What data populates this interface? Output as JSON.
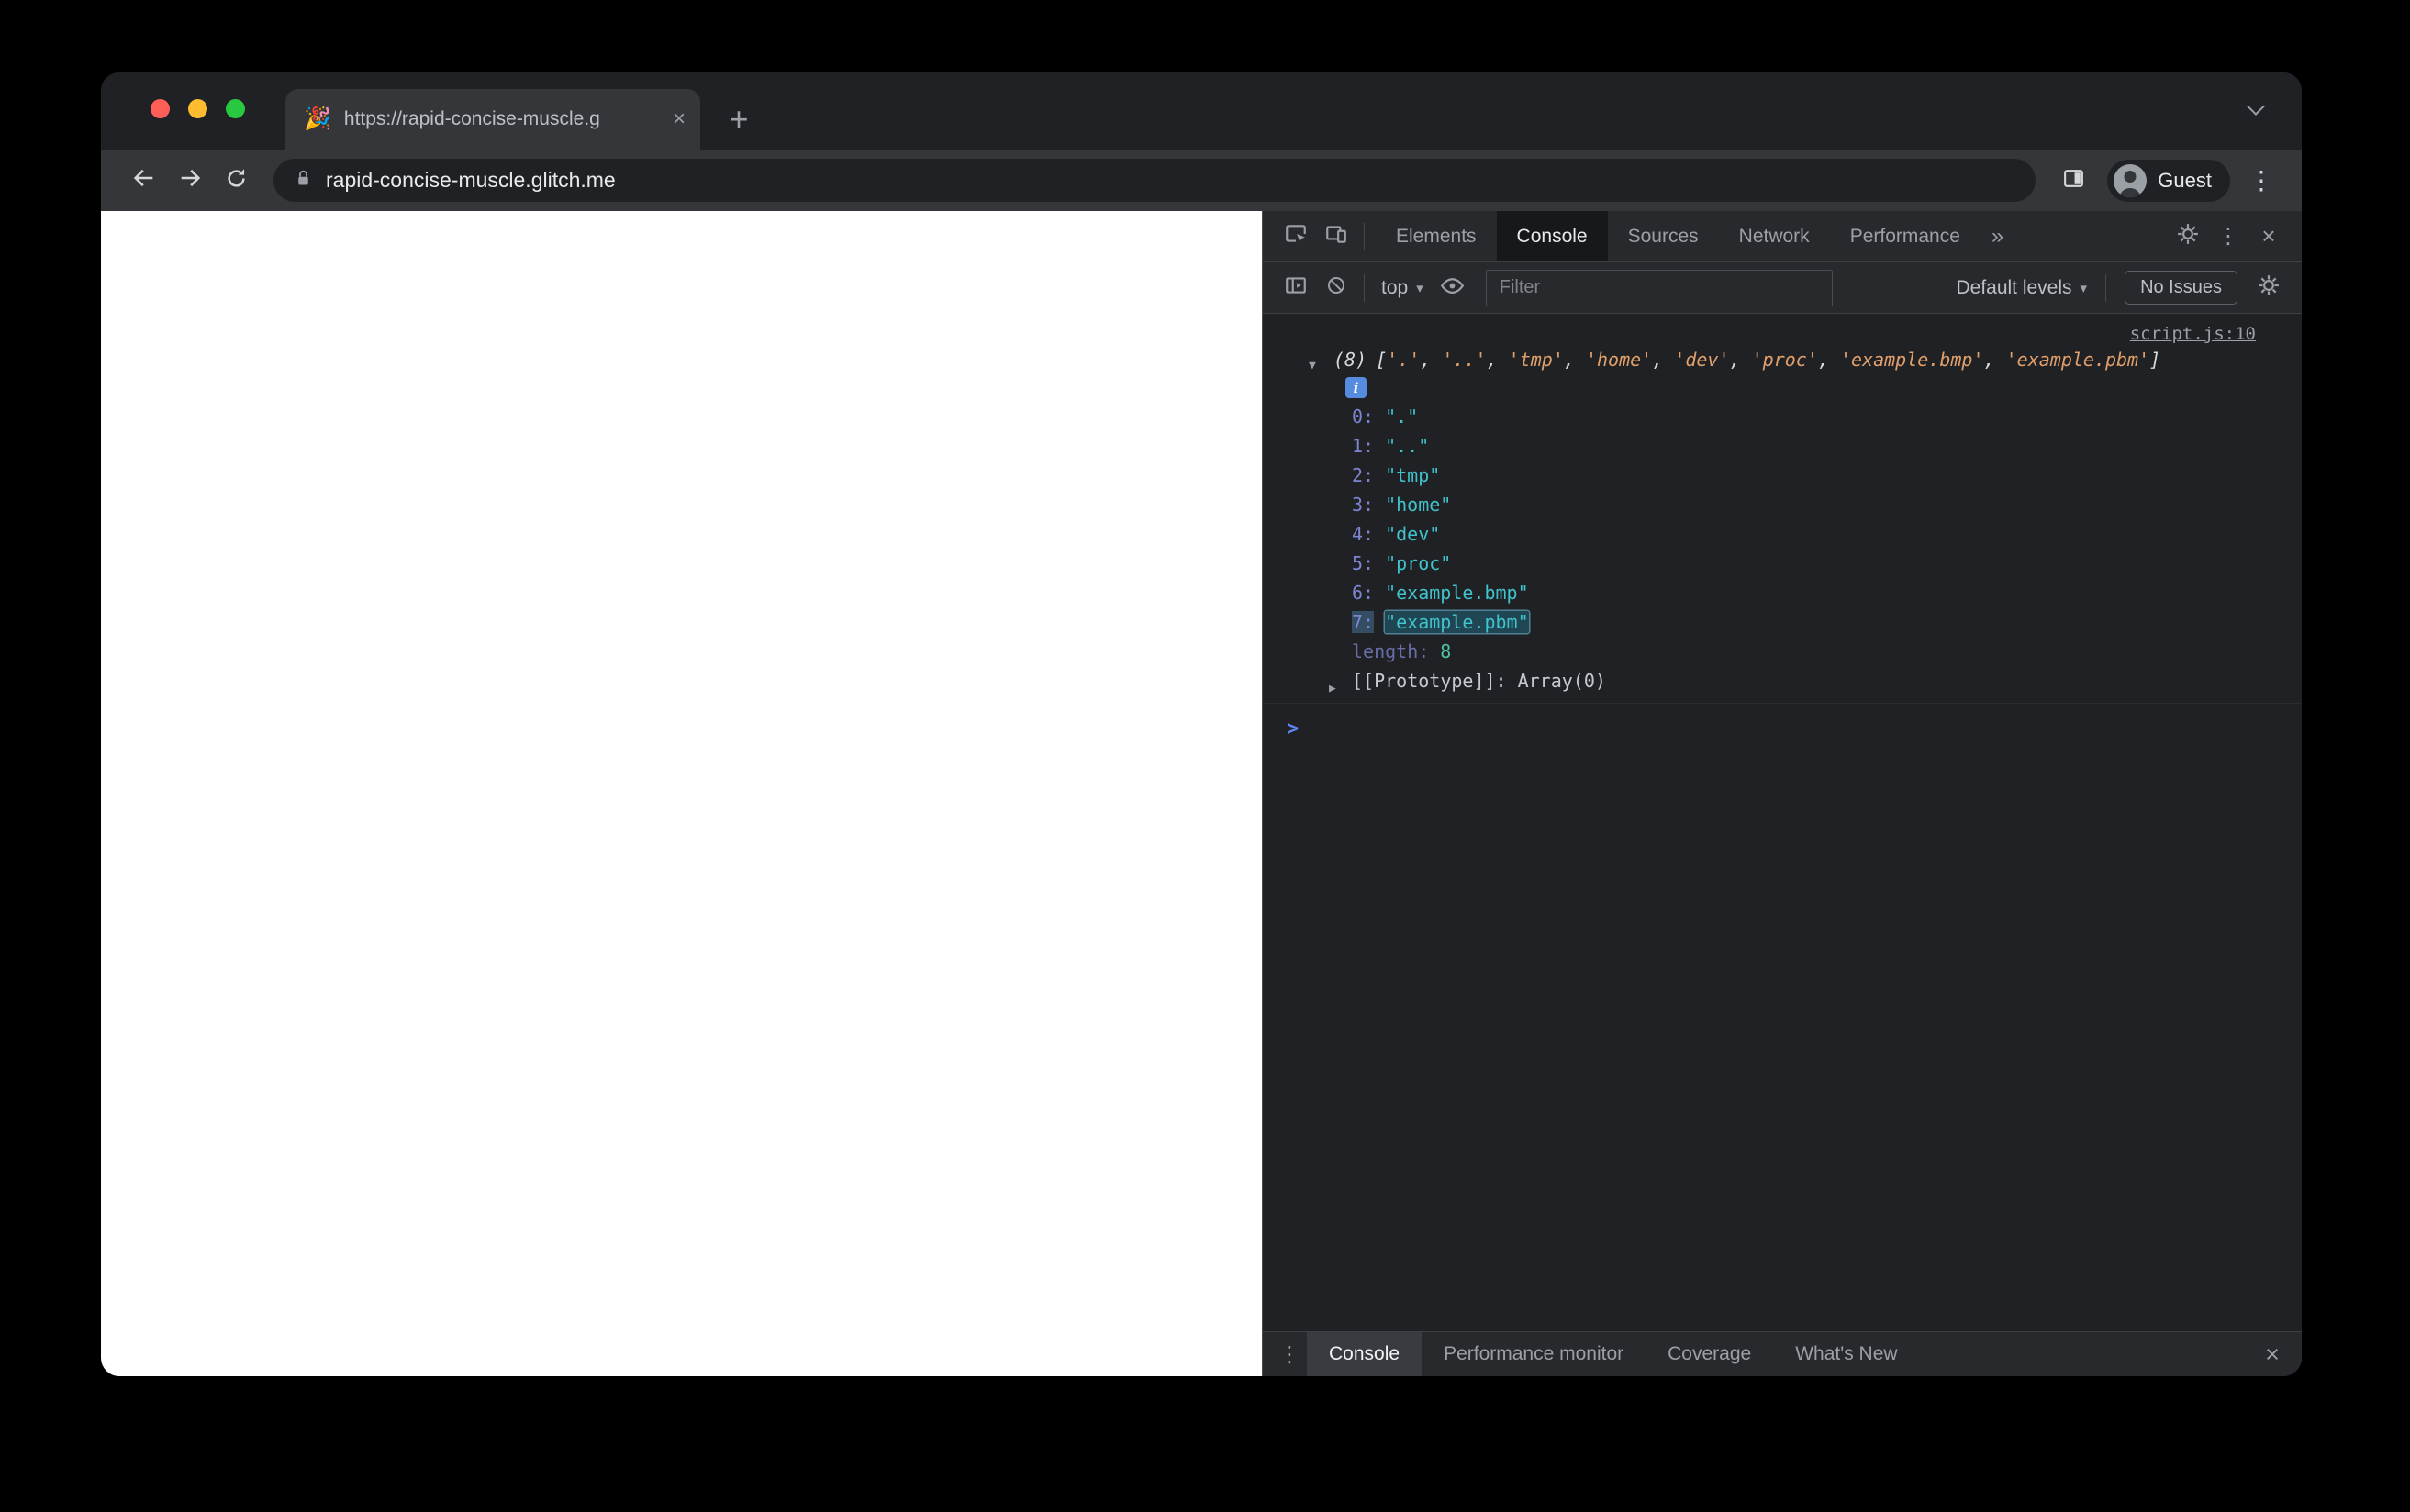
{
  "colors": {
    "traffic_red": "#ff5f57",
    "traffic_yellow": "#febc2e",
    "traffic_green": "#28c840",
    "devtools_bg": "#202124",
    "toolbar_bg": "#28292d",
    "string_teal": "#3fc3cc",
    "key_violet": "#7d85d1",
    "preview_orange": "#e1a06b",
    "prompt_blue": "#5e82f2",
    "info_blue": "#568cdf"
  },
  "icons": {
    "plus": "+",
    "close": "×",
    "menu_dots": "⋮",
    "more_tabs": "»",
    "caret_down": "▾",
    "triangle_open": "▼",
    "triangle_closed": "▶",
    "prompt": ">",
    "info": "i"
  },
  "browser": {
    "favicon": "🎉",
    "tab_title": "https://rapid-concise-muscle.g",
    "url": "rapid-concise-muscle.glitch.me",
    "profile_label": "Guest"
  },
  "devtools": {
    "tabs": [
      "Elements",
      "Console",
      "Sources",
      "Network",
      "Performance"
    ],
    "active_tab": "Console",
    "context_label": "top",
    "filter_placeholder": "Filter",
    "levels_label": "Default levels",
    "issues_label": "No Issues",
    "drawer_tabs": [
      "Console",
      "Performance monitor",
      "Coverage",
      "What's New"
    ],
    "active_drawer_tab": "Console",
    "console": {
      "source_link": "script.js:10",
      "preview_count": "(8)",
      "bracket_open": "[",
      "bracket_close": "]",
      "preview_items": [
        "'.'",
        "'..'",
        "'tmp'",
        "'home'",
        "'dev'",
        "'proc'",
        "'example.bmp'",
        "'example.pbm'"
      ],
      "entries": [
        {
          "key": "0:",
          "value": "\".\""
        },
        {
          "key": "1:",
          "value": "\"..\""
        },
        {
          "key": "2:",
          "value": "\"tmp\""
        },
        {
          "key": "3:",
          "value": "\"home\""
        },
        {
          "key": "4:",
          "value": "\"dev\""
        },
        {
          "key": "5:",
          "value": "\"proc\""
        },
        {
          "key": "6:",
          "value": "\"example.bmp\""
        },
        {
          "key": "7:",
          "value": "\"example.pbm\"",
          "highlighted": true
        }
      ],
      "length_key": "length:",
      "length_value": "8",
      "proto_key": "[[Prototype]]:",
      "proto_value": "Array(0)"
    }
  }
}
